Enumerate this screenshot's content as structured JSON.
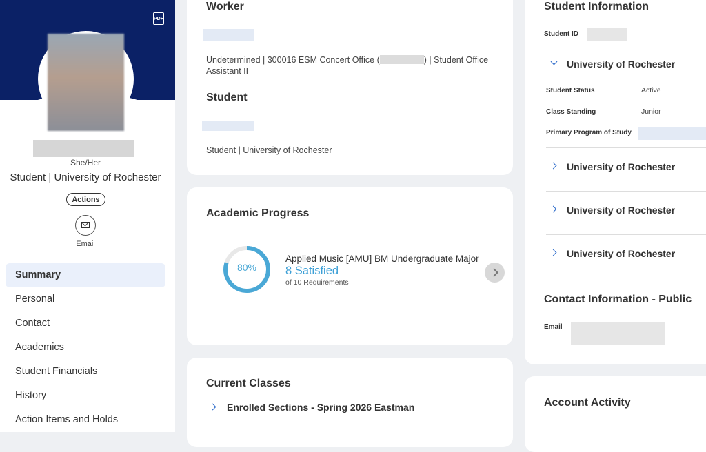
{
  "sidebar": {
    "pdf_label": "PDF",
    "pronouns": "She/Her",
    "role": "Student | University of Rochester",
    "actions_label": "Actions",
    "email_label": "Email",
    "nav": [
      {
        "label": "Summary",
        "active": true
      },
      {
        "label": "Personal"
      },
      {
        "label": "Contact"
      },
      {
        "label": "Academics"
      },
      {
        "label": "Student Financials"
      },
      {
        "label": "History"
      },
      {
        "label": "Action Items and Holds"
      }
    ]
  },
  "worker": {
    "title": "Worker",
    "detail_part1": "Undetermined | 300016 ESM Concert Office (",
    "detail_part2": ") | Student Office",
    "detail_line2": "Assistant II"
  },
  "student": {
    "title": "Student",
    "detail": "Student | University of Rochester"
  },
  "academic_progress": {
    "title": "Academic Progress",
    "percent": 80,
    "percent_label": "80%",
    "program": "Applied Music [AMU] BM Undergraduate Major",
    "satisfied": "8 Satisfied",
    "of_requirements": "of 10 Requirements"
  },
  "current_classes": {
    "title": "Current Classes",
    "item": "Enrolled Sections - Spring 2026 Eastman"
  },
  "student_information": {
    "title": "Student Information",
    "student_id_label": "Student ID",
    "expanded": {
      "name": "University of Rochester",
      "rows": [
        {
          "label": "Student Status",
          "value": "Active"
        },
        {
          "label": "Class Standing",
          "value": "Junior"
        },
        {
          "label": "Primary Program of Study",
          "value": ""
        }
      ]
    },
    "collapsed": [
      "University of Rochester",
      "University of Rochester",
      "University of Rochester"
    ]
  },
  "contact_public": {
    "title": "Contact Information - Public",
    "email_label": "Email"
  },
  "account_activity": {
    "title": "Account Activity"
  },
  "colors": {
    "banner": "#0b2166",
    "accent_blue": "#3c9fd6",
    "chevron_blue": "#2767c9",
    "active_nav_bg": "#eaf0fb"
  }
}
